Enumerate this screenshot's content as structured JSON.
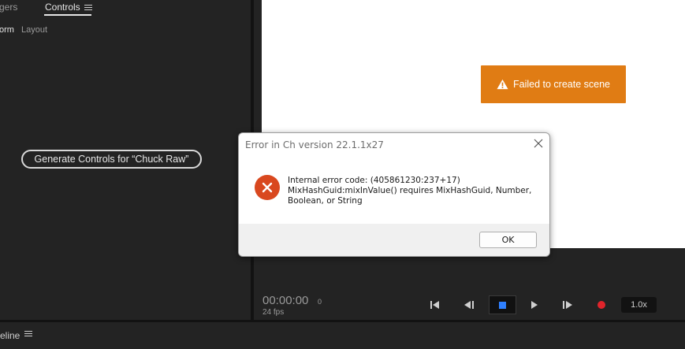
{
  "left_panel": {
    "tabs": [
      {
        "label": "gers"
      },
      {
        "label": "Controls"
      }
    ],
    "subtabs": [
      {
        "label": "orm"
      },
      {
        "label": "Layout"
      }
    ],
    "generate_button": "Generate Controls for “Chuck Raw”"
  },
  "stage": {
    "failure_banner": "Failed to create scene"
  },
  "transport": {
    "timecode": "00:00:00",
    "frame": "0",
    "fps": "24 fps",
    "speed": "1.0x",
    "stop_color": "#2f80ff",
    "record_color": "#e0242b"
  },
  "bottom": {
    "label": "eline"
  },
  "dialog": {
    "title": "Error in Ch version 22.1.1x27",
    "message_lines": [
      "Internal error code: (405861230:237+17)",
      "MixHashGuid:mixInValue() requires MixHashGuid, Number,",
      "Boolean, or String"
    ],
    "ok_label": "OK",
    "icon_color": "#d9481f"
  },
  "colors": {
    "accent_orange": "#e07c14",
    "panel_bg": "#232323"
  }
}
